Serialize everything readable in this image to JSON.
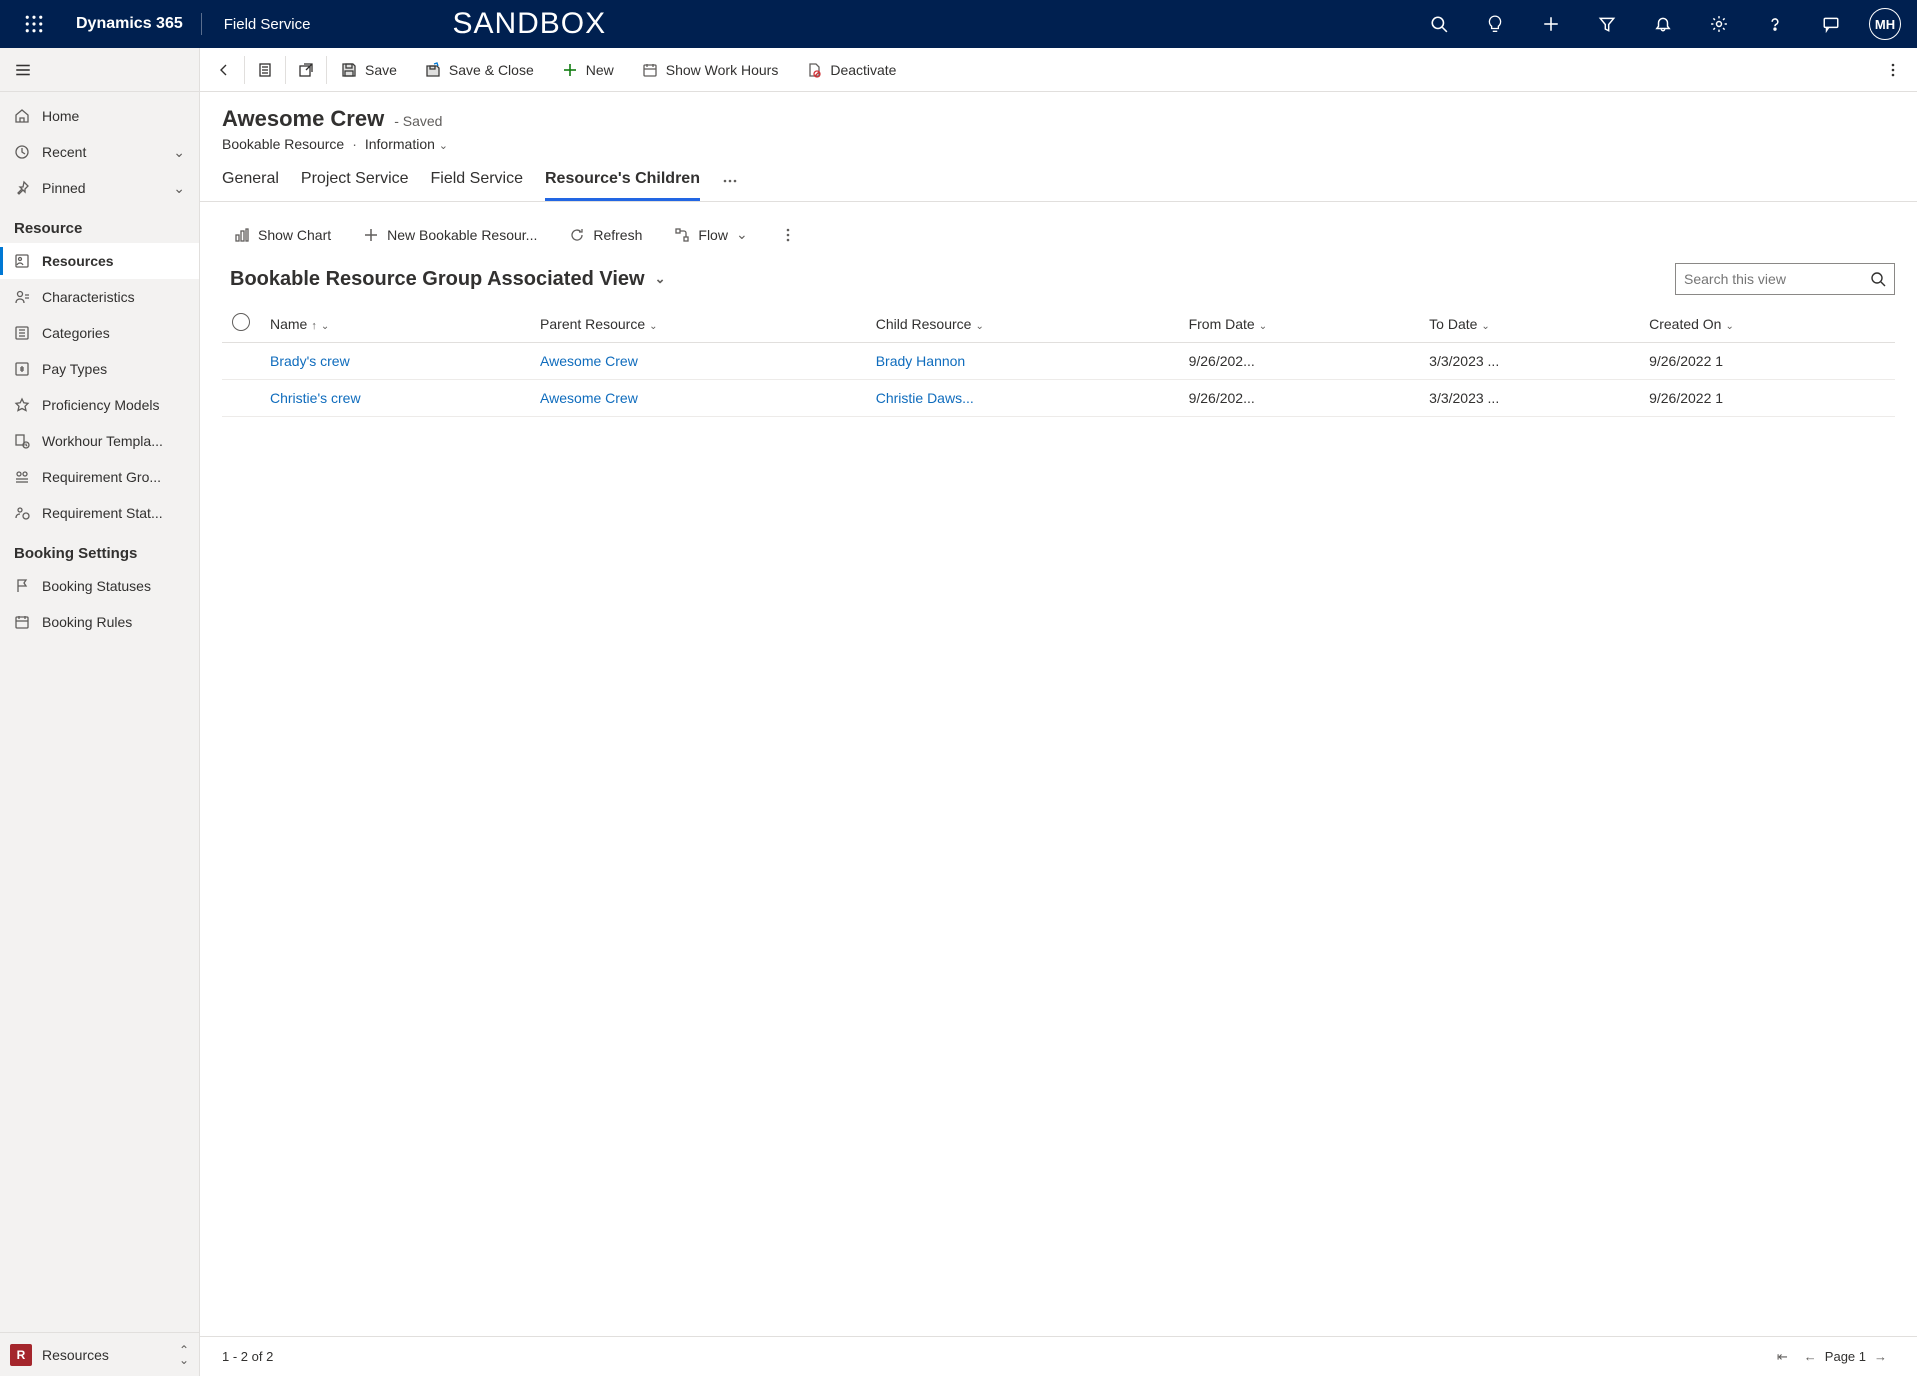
{
  "topbar": {
    "brand": "Dynamics 365",
    "app_name": "Field Service",
    "env_label": "SANDBOX",
    "avatar_initials": "MH"
  },
  "sidebar": {
    "home": "Home",
    "recent": "Recent",
    "pinned": "Pinned",
    "section_resource": "Resource",
    "items_resource": [
      "Resources",
      "Characteristics",
      "Categories",
      "Pay Types",
      "Proficiency Models",
      "Workhour Templa...",
      "Requirement Gro...",
      "Requirement Stat..."
    ],
    "section_booking": "Booking Settings",
    "items_booking": [
      "Booking Statuses",
      "Booking Rules"
    ],
    "area_badge": "R",
    "area_label": "Resources"
  },
  "cmdbar": {
    "save": "Save",
    "save_close": "Save & Close",
    "new": "New",
    "show_work_hours": "Show Work Hours",
    "deactivate": "Deactivate"
  },
  "record": {
    "title": "Awesome Crew",
    "saved": "- Saved",
    "entity_label": "Bookable Resource",
    "form_label": "Information"
  },
  "tabs": {
    "items": [
      "General",
      "Project Service",
      "Field Service",
      "Resource's Children"
    ],
    "active_index": 3
  },
  "subgrid": {
    "show_chart": "Show Chart",
    "new_resource": "New Bookable Resour...",
    "refresh": "Refresh",
    "flow": "Flow",
    "view_title": "Bookable Resource Group Associated View",
    "search_placeholder": "Search this view",
    "columns": [
      "Name",
      "Parent Resource",
      "Child Resource",
      "From Date",
      "To Date",
      "Created On"
    ],
    "rows": [
      {
        "name": "Brady's crew",
        "parent": "Awesome Crew",
        "child": "Brady Hannon",
        "from": "9/26/202...",
        "to": "3/3/2023 ...",
        "created": "9/26/2022 1"
      },
      {
        "name": "Christie's crew",
        "parent": "Awesome Crew",
        "child": "Christie Daws...",
        "from": "9/26/202...",
        "to": "3/3/2023 ...",
        "created": "9/26/2022 1"
      }
    ]
  },
  "pager": {
    "range": "1 - 2 of 2",
    "page": "Page 1"
  }
}
